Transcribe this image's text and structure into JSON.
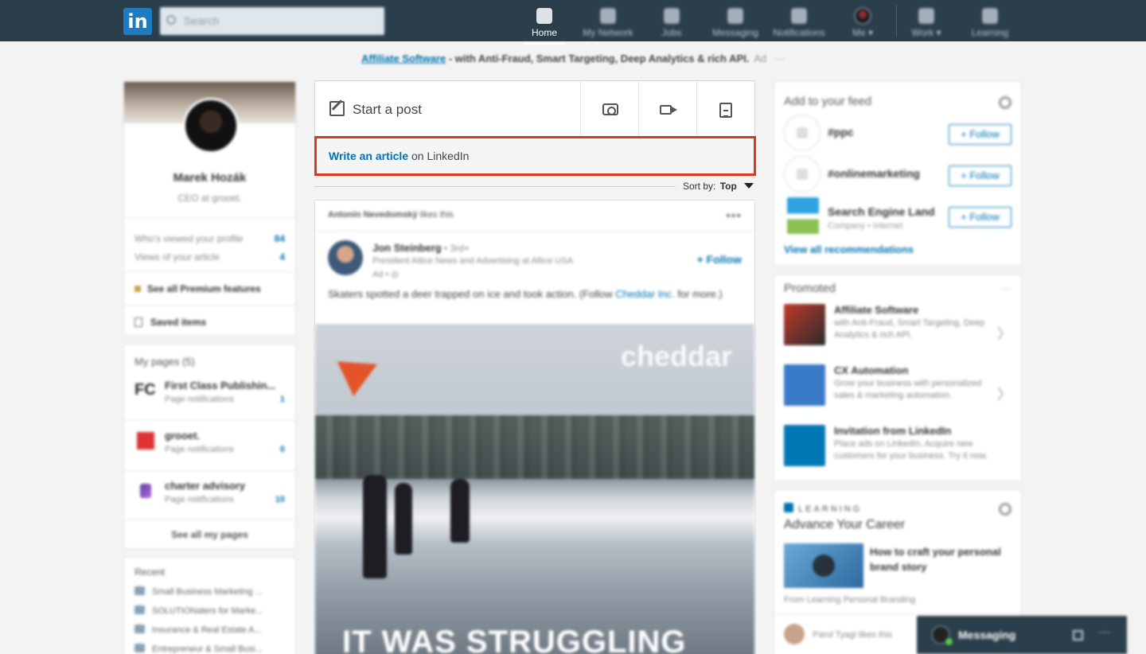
{
  "nav": {
    "logo": "in",
    "search_placeholder": "Search",
    "items": [
      {
        "label": "Home",
        "icon": "home-icon",
        "active": true
      },
      {
        "label": "My Network",
        "icon": "network-icon"
      },
      {
        "label": "Jobs",
        "icon": "briefcase-icon"
      },
      {
        "label": "Messaging",
        "icon": "chat-icon"
      },
      {
        "label": "Notifications",
        "icon": "bell-icon"
      },
      {
        "label": "Me ▾",
        "icon": "avatar"
      },
      {
        "label": "Work ▾",
        "icon": "grid-icon"
      },
      {
        "label": "Learning",
        "icon": "play-icon"
      }
    ]
  },
  "ad_banner": {
    "link": "Affiliate Software",
    "text": " - with Anti-Fraud, Smart Targeting, Deep Analytics & rich API.",
    "ad": "Ad",
    "more": "···"
  },
  "profile": {
    "name": "Marek Hozák",
    "title": "CEO at grooet.",
    "stats": [
      {
        "label": "Who's viewed your profile",
        "value": "84"
      },
      {
        "label": "Views of your article",
        "value": "4"
      }
    ],
    "premium": "See all Premium features",
    "saved": "Saved items"
  },
  "my_pages": {
    "header": "My pages (5)",
    "pages": [
      {
        "logo": "FC",
        "name": "First Class Publishin...",
        "sub": "Page notifications",
        "count": "1"
      },
      {
        "logo": "",
        "name": "grooet.",
        "sub": "Page notifications",
        "count": "0"
      },
      {
        "logo": "",
        "name": "charter advisory",
        "sub": "Page notifications",
        "count": "10"
      }
    ],
    "see_all": "See all my pages"
  },
  "recent": {
    "header": "Recent",
    "items": [
      "Small Business Marketing ...",
      "SOLUTIONaters for Marke...",
      "Insurance & Real Estate A...",
      "Entrepreneur & Small Busi..."
    ]
  },
  "share": {
    "start_post": "Start a post",
    "article_link": "Write an article",
    "article_rest": " on LinkedIn",
    "sort_label": "Sort by:",
    "sort_value": "Top"
  },
  "post": {
    "liked_by": "Antonín Nevedomský",
    "liked_suffix": " likes this",
    "more": "•••",
    "author": "Jon Steinberg",
    "degree": " • 3rd+",
    "author_title": "President Altice News and Advertising at Altice USA",
    "ad_label": "Ad • ◎",
    "follow": "+ Follow",
    "text_before": "Skaters spotted a deer trapped on ice and took action. (Follow ",
    "text_link": "Cheddar Inc.",
    "text_after": " for more.)",
    "video_brand": "cheddar",
    "video_caption": "IT WAS STRUGGLING"
  },
  "feed_suggestions": {
    "header": "Add to your feed",
    "items": [
      {
        "name": "#ppc",
        "sub": "",
        "follow": "+ Follow"
      },
      {
        "name": "#onlinemarketing",
        "sub": "",
        "follow": "+ Follow"
      },
      {
        "name": "Search Engine Land",
        "sub": "Company • Internet",
        "follow": "+ Follow"
      }
    ],
    "view_all": "View all recommendations"
  },
  "promoted": {
    "header": "Promoted",
    "more": "···",
    "items": [
      {
        "name": "Affiliate Software",
        "desc": "with Anti-Fraud, Smart Targeting, Deep Analytics & rich API.",
        "color": "#3b3b3b"
      },
      {
        "name": "CX Automation",
        "desc": "Grow your business with personalized sales & marketing automation.",
        "color": "#3a7bc8"
      },
      {
        "name": "Invitation from LinkedIn",
        "desc": "Place ads on LinkedIn. Acquire new customers for your business. Try it now.",
        "color": "#0077b5"
      }
    ]
  },
  "learning": {
    "brand": "LEARNING",
    "title": "Advance Your Career",
    "course_title": "How to craft your personal brand story",
    "course_from": "From Learning Personal Branding",
    "viewed_by": "Parul Tyagi",
    "viewed_suffix": " likes this"
  },
  "messaging": {
    "label": "Messaging"
  },
  "colors": {
    "nav_bg": "#2b3e4c",
    "accent": "#0073b1",
    "highlight": "#d9391f"
  }
}
